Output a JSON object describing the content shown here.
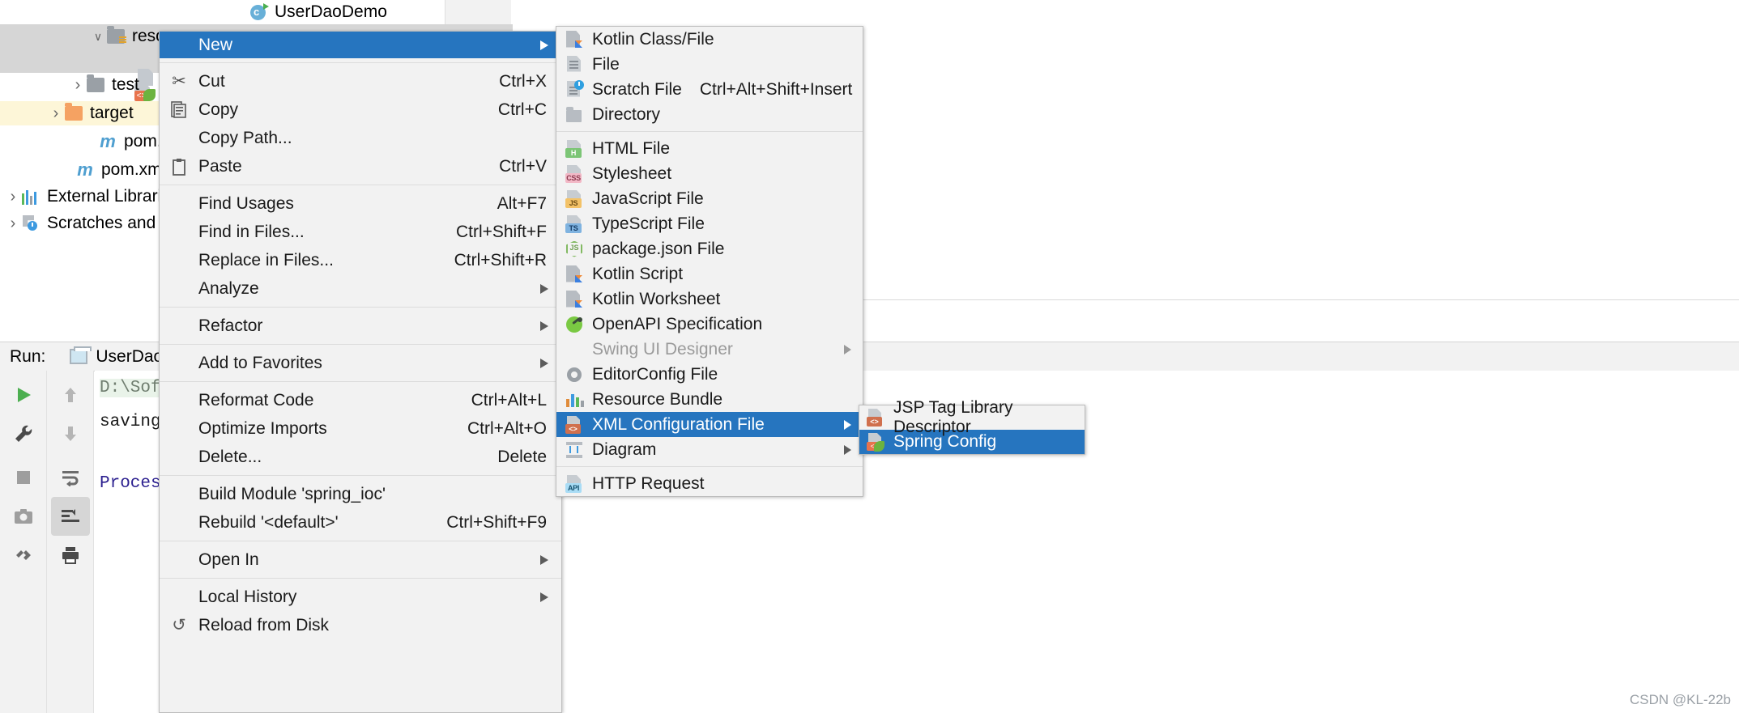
{
  "editor": {
    "tab_label": "UserDaoDemo",
    "tab_icon": "kotlin-class-run-icon"
  },
  "project_tree": {
    "items": [
      {
        "label": "resources",
        "chevron": "down",
        "icon": "folder-resources-icon",
        "state": "selected-grey",
        "indent": 110
      },
      {
        "label": "test",
        "chevron": "right",
        "icon": "folder-grey-icon",
        "state": "normal",
        "indent": 85
      },
      {
        "label": "target",
        "chevron": "right",
        "icon": "folder-orange-icon",
        "state": "selected-yellow",
        "indent": 58
      },
      {
        "label": "pom.xml",
        "chevron": "blank",
        "icon": "maven-m-icon",
        "state": "normal",
        "indent": 100
      },
      {
        "label": "pom.xml",
        "chevron": "blank",
        "icon": "maven-m-icon",
        "state": "normal",
        "indent": 72
      },
      {
        "label": "External Librarie",
        "chevron": "right",
        "icon": "external-libraries-icon",
        "state": "normal",
        "indent": 5
      },
      {
        "label": "Scratches and C",
        "chevron": "right",
        "icon": "scratches-icon",
        "state": "normal",
        "indent": 5
      }
    ]
  },
  "run_panel": {
    "label": "Run:",
    "tab_label": "UserDaoDe",
    "console_lines": [
      {
        "text": "D:\\Softw",
        "highlight": true
      },
      {
        "text": "saving r",
        "highlight": false
      },
      {
        "text": "Process",
        "highlight": false
      }
    ],
    "toolbar_left": [
      "run-icon",
      "wrench-icon",
      "stop-icon",
      "camera-icon",
      "threads-icon"
    ],
    "toolbar_right": [
      "arrow-up-icon",
      "arrow-down-icon",
      "soft-wrap-icon",
      "scroll-to-end-icon",
      "print-icon"
    ]
  },
  "context_menu": {
    "items": [
      {
        "label": "New",
        "accel": "",
        "icon": "",
        "submenu": true,
        "highlighted": true
      },
      {
        "sep": true
      },
      {
        "label": "Cut",
        "accel": "Ctrl+X",
        "icon": "scissors-icon",
        "submenu": false,
        "mnemonic": "t"
      },
      {
        "label": "Copy",
        "accel": "Ctrl+C",
        "icon": "copy-icon",
        "submenu": false,
        "mnemonic": "C"
      },
      {
        "label": "Copy Path...",
        "accel": "",
        "icon": "",
        "submenu": false
      },
      {
        "label": "Paste",
        "accel": "Ctrl+V",
        "icon": "paste-icon",
        "submenu": false,
        "mnemonic": "P"
      },
      {
        "sep": true
      },
      {
        "label": "Find Usages",
        "accel": "Alt+F7",
        "icon": "",
        "submenu": false,
        "mnemonic": "U"
      },
      {
        "label": "Find in Files...",
        "accel": "Ctrl+Shift+F",
        "icon": "",
        "submenu": false
      },
      {
        "label": "Replace in Files...",
        "accel": "Ctrl+Shift+R",
        "icon": "",
        "submenu": false,
        "mnemonic": "a"
      },
      {
        "label": "Analyze",
        "accel": "",
        "icon": "",
        "submenu": true,
        "mnemonic": "z"
      },
      {
        "sep": true
      },
      {
        "label": "Refactor",
        "accel": "",
        "icon": "",
        "submenu": true,
        "mnemonic": "R"
      },
      {
        "sep": true
      },
      {
        "label": "Add to Favorites",
        "accel": "",
        "icon": "",
        "submenu": true,
        "mnemonic": "a"
      },
      {
        "sep": true
      },
      {
        "label": "Reformat Code",
        "accel": "Ctrl+Alt+L",
        "icon": "",
        "submenu": false,
        "mnemonic": "R"
      },
      {
        "label": "Optimize Imports",
        "accel": "Ctrl+Alt+O",
        "icon": "",
        "submenu": false,
        "mnemonic": "z"
      },
      {
        "label": "Delete...",
        "accel": "Delete",
        "icon": "",
        "submenu": false,
        "mnemonic": "D"
      },
      {
        "sep": true
      },
      {
        "label": "Build Module 'spring_ioc'",
        "accel": "",
        "icon": "",
        "submenu": false,
        "mnemonic": "M"
      },
      {
        "label": "Rebuild '<default>'",
        "accel": "Ctrl+Shift+F9",
        "icon": "",
        "submenu": false,
        "mnemonic": "e"
      },
      {
        "sep": true
      },
      {
        "label": "Open In",
        "accel": "",
        "icon": "",
        "submenu": true
      },
      {
        "sep": true
      },
      {
        "label": "Local History",
        "accel": "",
        "icon": "",
        "submenu": true,
        "mnemonic": "H"
      },
      {
        "label": "Reload from Disk",
        "accel": "",
        "icon": "reload-icon",
        "submenu": false
      }
    ]
  },
  "new_submenu": {
    "items": [
      {
        "label": "Kotlin Class/File",
        "icon": "kotlin-class-icon",
        "accel": "",
        "submenu": false,
        "disabled": false
      },
      {
        "label": "File",
        "icon": "file-icon",
        "accel": "",
        "submenu": false,
        "disabled": false
      },
      {
        "label": "Scratch File",
        "icon": "scratch-file-icon",
        "accel": "Ctrl+Alt+Shift+Insert",
        "submenu": false,
        "disabled": false
      },
      {
        "label": "Directory",
        "icon": "directory-icon",
        "accel": "",
        "submenu": false,
        "disabled": false
      },
      {
        "sep": true
      },
      {
        "label": "HTML File",
        "icon": "html-file-icon",
        "accel": "",
        "submenu": false,
        "disabled": false
      },
      {
        "label": "Stylesheet",
        "icon": "css-file-icon",
        "accel": "",
        "submenu": false,
        "disabled": false
      },
      {
        "label": "JavaScript File",
        "icon": "javascript-file-icon",
        "accel": "",
        "submenu": false,
        "disabled": false
      },
      {
        "label": "TypeScript File",
        "icon": "typescript-file-icon",
        "accel": "",
        "submenu": false,
        "disabled": false
      },
      {
        "label": "package.json File",
        "icon": "nodejs-icon",
        "accel": "",
        "submenu": false,
        "disabled": false
      },
      {
        "label": "Kotlin Script",
        "icon": "kotlin-script-icon",
        "accel": "",
        "submenu": false,
        "disabled": false
      },
      {
        "label": "Kotlin Worksheet",
        "icon": "kotlin-worksheet-icon",
        "accel": "",
        "submenu": false,
        "disabled": false
      },
      {
        "label": "OpenAPI Specification",
        "icon": "openapi-icon",
        "accel": "",
        "submenu": false,
        "disabled": false
      },
      {
        "label": "Swing UI Designer",
        "icon": "",
        "accel": "",
        "submenu": true,
        "disabled": true
      },
      {
        "label": "EditorConfig File",
        "icon": "gear-icon",
        "accel": "",
        "submenu": false,
        "disabled": false
      },
      {
        "label": "Resource Bundle",
        "icon": "resource-bundle-icon",
        "accel": "",
        "submenu": false,
        "disabled": false
      },
      {
        "label": "XML Configuration File",
        "icon": "xml-config-icon",
        "accel": "",
        "submenu": true,
        "disabled": false,
        "highlighted": true
      },
      {
        "label": "Diagram",
        "icon": "diagram-icon",
        "accel": "",
        "submenu": true,
        "disabled": false
      },
      {
        "sep": true
      },
      {
        "label": "HTTP Request",
        "icon": "http-request-icon",
        "accel": "",
        "submenu": false,
        "disabled": false
      }
    ]
  },
  "xml_config_submenu": {
    "items": [
      {
        "label": "JSP Tag Library Descriptor",
        "icon": "jsp-tld-icon",
        "highlighted": false
      },
      {
        "label": "Spring Config",
        "icon": "spring-config-icon",
        "highlighted": true
      }
    ]
  },
  "watermark": {
    "text": "CSDN @KL-22b"
  },
  "colors": {
    "menu_highlight": "#2675bf",
    "menu_background": "#f2f2f2",
    "tree_selection_grey": "#d6d6d6",
    "tree_selection_yellow": "#fdf6d8",
    "kotlin_orange": "#ef8b3b",
    "spring_green": "#6cb33f"
  }
}
